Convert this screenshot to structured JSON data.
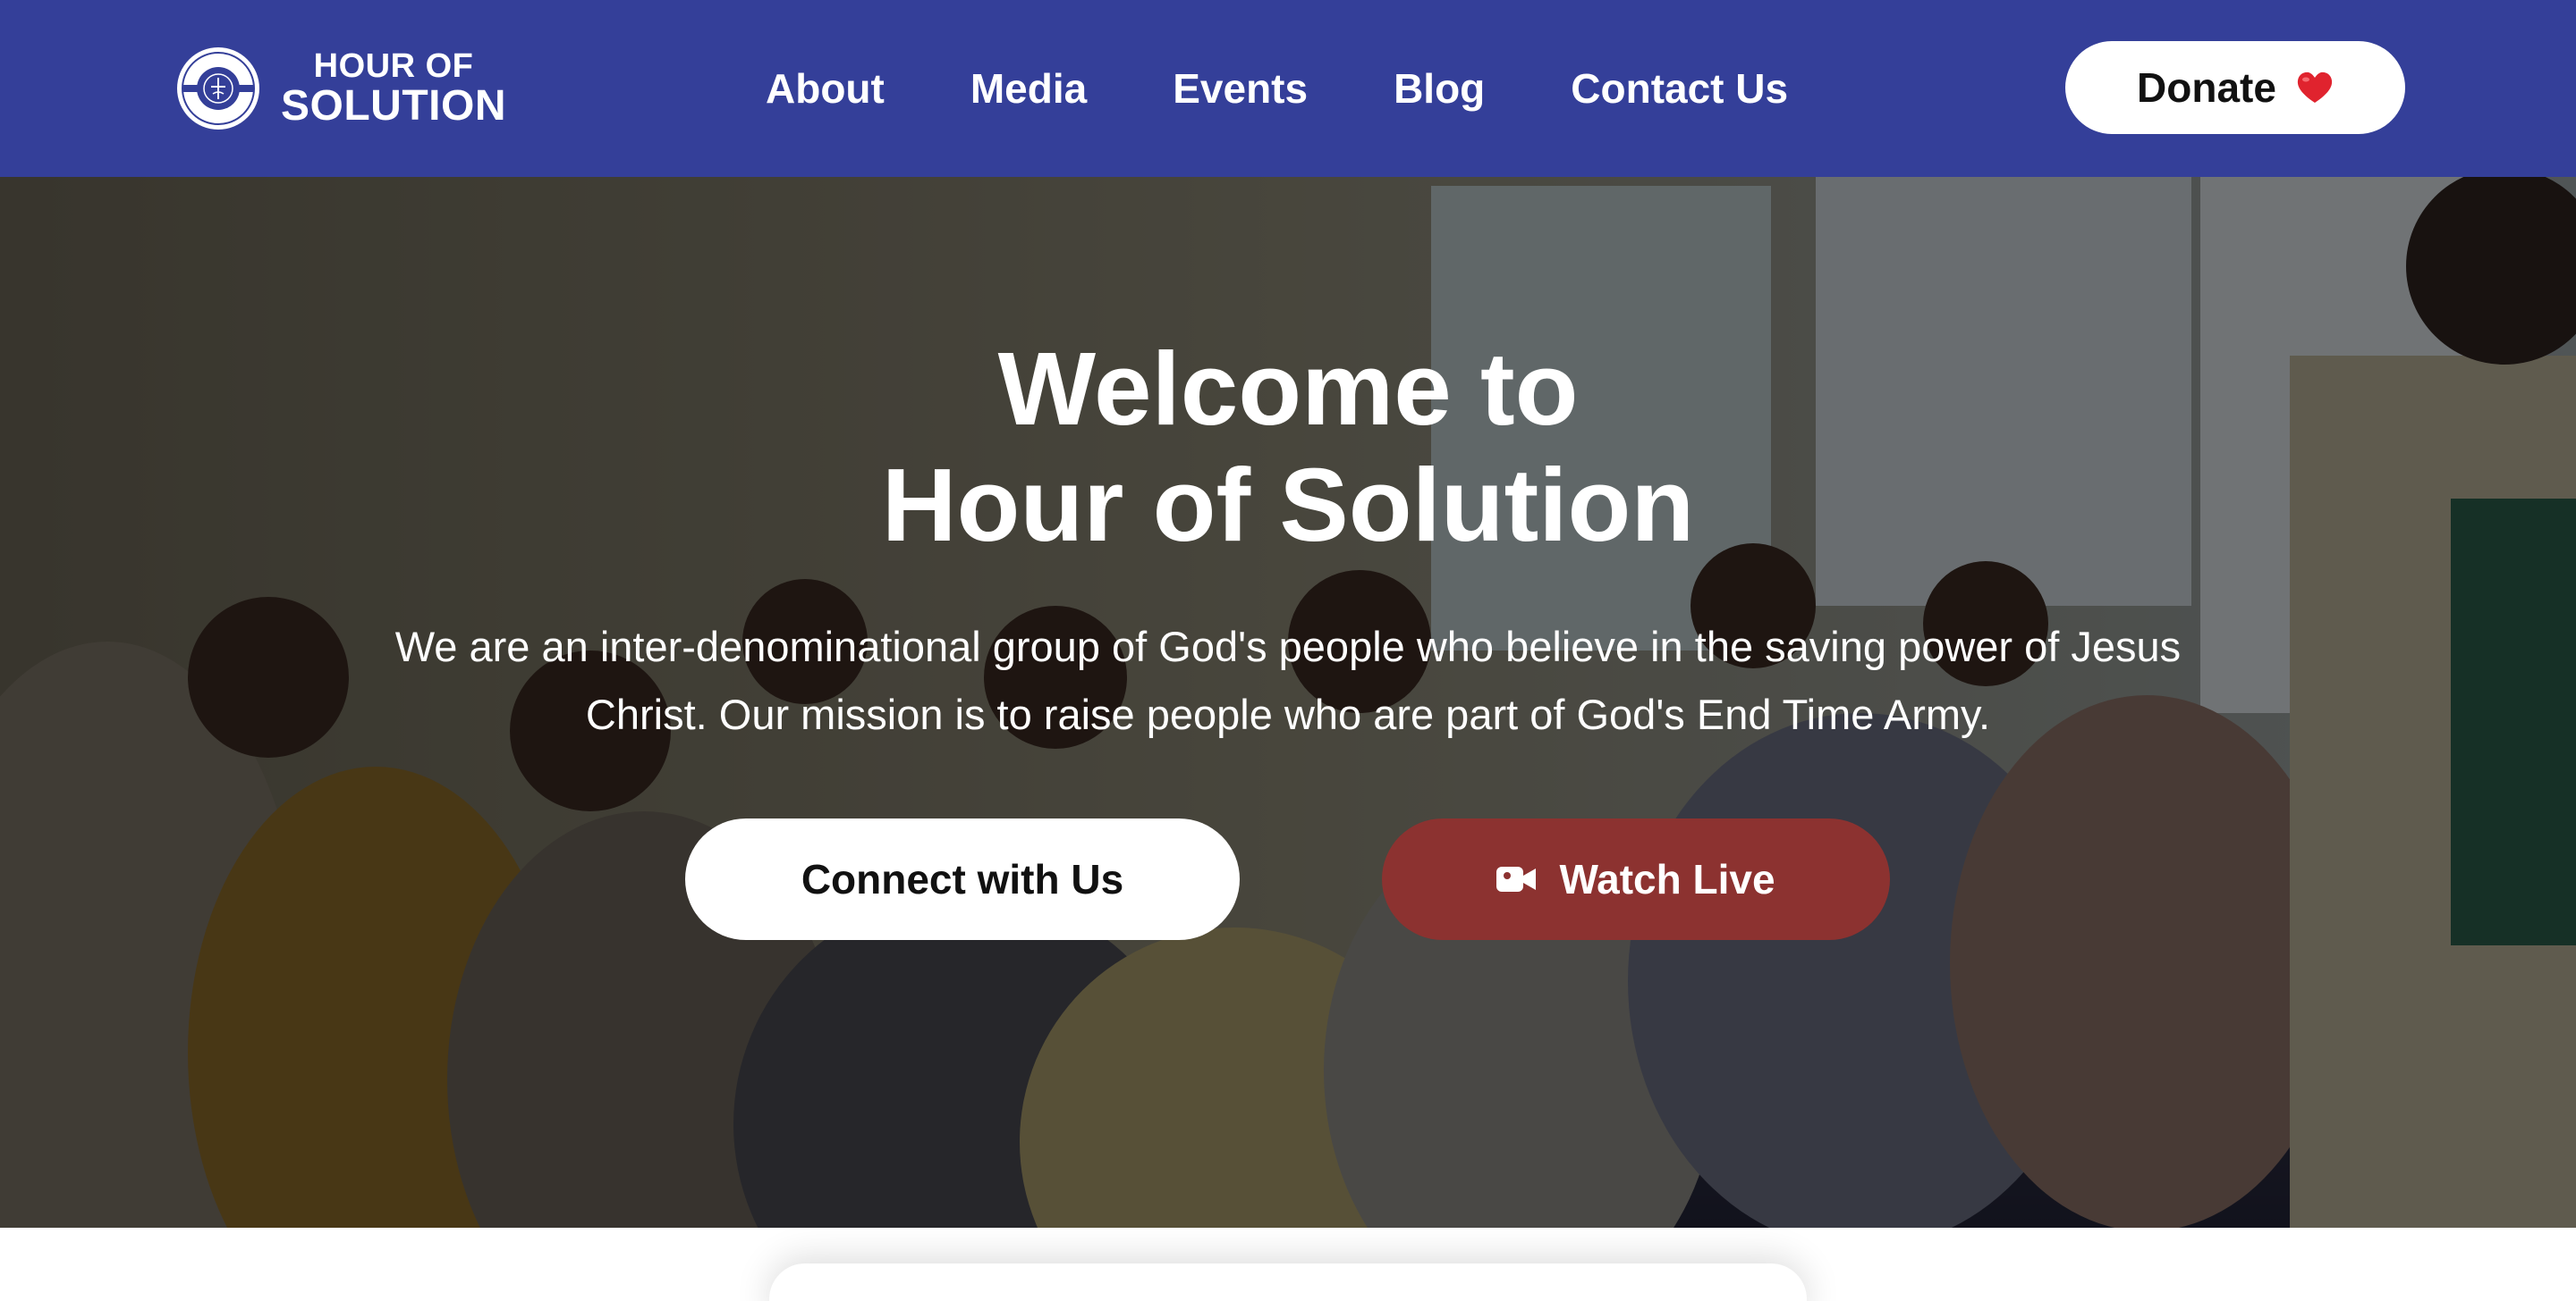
{
  "header": {
    "logo": {
      "line1": "HOUR OF",
      "line2": "SOLUTION",
      "icon": "church-seal-logo-icon"
    },
    "nav": [
      {
        "label": "About"
      },
      {
        "label": "Media"
      },
      {
        "label": "Events"
      },
      {
        "label": "Blog"
      },
      {
        "label": "Contact Us"
      }
    ],
    "donate": {
      "label": "Donate",
      "icon": "heart-icon"
    }
  },
  "hero": {
    "title_line1": "Welcome to",
    "title_line2": "Hour of Solution",
    "description": "We are an inter-denominational group of God's people who believe in the saving power of Jesus Christ. Our mission is to raise people who are part of God's End Time Army.",
    "buttons": {
      "connect": {
        "label": "Connect with Us"
      },
      "watch": {
        "label": "Watch Live",
        "icon": "video-camera-icon"
      }
    },
    "background": "congregation-photo"
  },
  "colors": {
    "header_bg": "#343f99",
    "watch_live_bg": "#8c3230",
    "button_white": "#ffffff",
    "heart_red": "#e0232e"
  }
}
